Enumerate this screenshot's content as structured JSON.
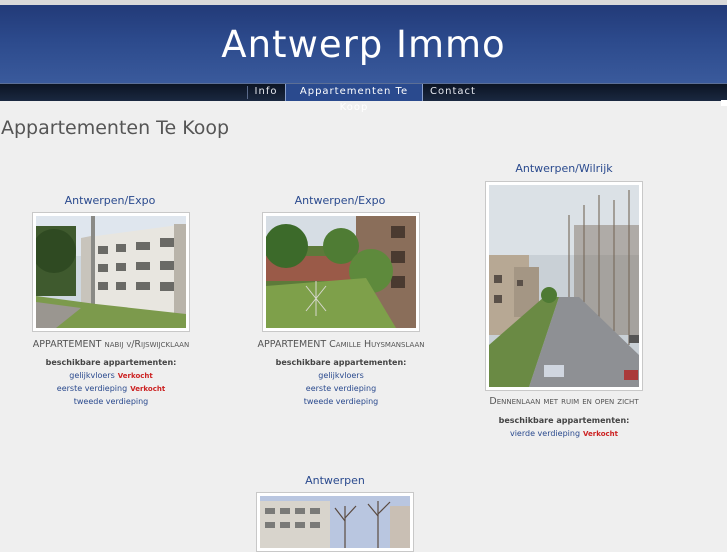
{
  "site": {
    "title": "Antwerp Immo"
  },
  "nav": {
    "items": [
      {
        "label": "Info",
        "active": false
      },
      {
        "label": "Appartementen Te Koop",
        "active": true
      },
      {
        "label": "Contact",
        "active": false
      }
    ]
  },
  "page": {
    "title": "Appartementen Te Koop"
  },
  "listings": [
    {
      "location": "Antwerpen/Expo",
      "caption": "APPARTEMENT nabij v/Rijswijcklaan",
      "available_heading": "beschikbare appartementen:",
      "units": [
        {
          "label": "gelijkvloers",
          "status": "Verkocht"
        },
        {
          "label": "eerste verdieping",
          "status": "Verkocht"
        },
        {
          "label": "tweede verdieping",
          "status": ""
        }
      ]
    },
    {
      "location": "Antwerpen/Expo",
      "caption": "APPARTEMENT Camille Huysmanslaan",
      "available_heading": "beschikbare appartementen:",
      "units": [
        {
          "label": "gelijkvloers",
          "status": ""
        },
        {
          "label": "eerste verdieping",
          "status": ""
        },
        {
          "label": "tweede verdieping",
          "status": ""
        }
      ]
    },
    {
      "location": "Antwerpen/Wilrijk",
      "caption": "Dennenlaan met ruim en open zicht",
      "available_heading": "beschikbare appartementen:",
      "units": [
        {
          "label": "vierde verdieping",
          "status": "Verkocht"
        }
      ]
    },
    {
      "location": "Antwerpen",
      "caption": "",
      "available_heading": "",
      "units": []
    }
  ],
  "colors": {
    "header": "#2c4a8c",
    "navbar": "#0c1424",
    "link": "#2a4a8e",
    "sold": "#cc2222",
    "background": "#efefef"
  }
}
